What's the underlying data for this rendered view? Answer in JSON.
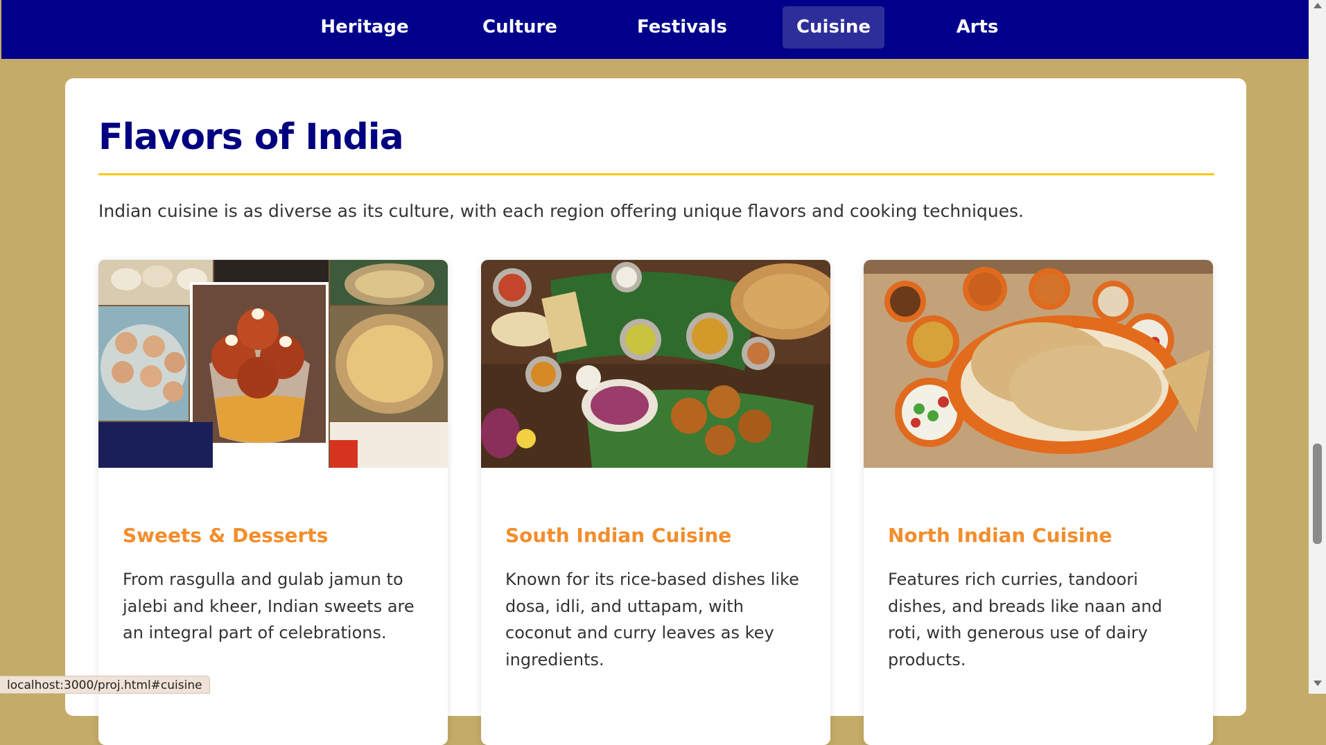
{
  "nav": {
    "items": [
      {
        "label": "Heritage",
        "active": false
      },
      {
        "label": "Culture",
        "active": false
      },
      {
        "label": "Festivals",
        "active": false
      },
      {
        "label": "Cuisine",
        "active": true
      },
      {
        "label": "Arts",
        "active": false
      }
    ]
  },
  "section": {
    "title": "Flavors of India",
    "intro": "Indian cuisine is as diverse as its culture, with each region offering unique flavors and cooking techniques."
  },
  "cards": [
    {
      "title": "Sweets & Desserts",
      "text": "From rasgulla and gulab jamun to jalebi and kheer, Indian sweets are an integral part of celebrations.",
      "image": "sweets-collage-image"
    },
    {
      "title": "South Indian Cuisine",
      "text": "Known for its rice-based dishes like dosa, idli, and uttapam, with coconut and curry leaves as key ingredients.",
      "image": "south-indian-thali-image"
    },
    {
      "title": "North Indian Cuisine",
      "text": "Features rich curries, tandoori dishes, and breads like naan and roti, with generous use of dairy products.",
      "image": "north-indian-platter-image"
    }
  ],
  "status": {
    "url": "localhost:3000/proj.html#cuisine"
  },
  "colors": {
    "page_bg": "#c4ab68",
    "nav_bg": "#00008b",
    "nav_active": "#2e2e9a",
    "title": "#000080",
    "underline": "#f6cb16",
    "card_title": "#f28d2c"
  }
}
